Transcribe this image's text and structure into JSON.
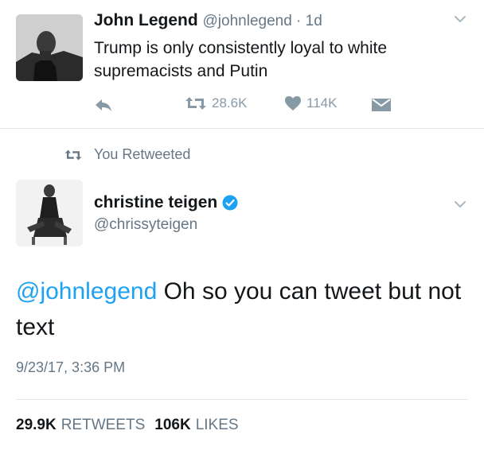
{
  "tweet1": {
    "author_name": "John Legend",
    "author_handle": "@johnlegend",
    "time_sep": " · ",
    "time_ago": "1d",
    "text": "Trump is only consistently loyal to white supremacists and Putin",
    "retweet_count": "28.6K",
    "like_count": "114K"
  },
  "retweet_banner": {
    "label": "You Retweeted"
  },
  "tweet2": {
    "author_name": "christine teigen",
    "author_handle": "@chrissyteigen",
    "mention": "@johnlegend",
    "text": " Oh so you can tweet but not text",
    "timestamp": "9/23/17, 3:36 PM",
    "retweets_count": "29.9K",
    "retweets_label": "RETWEETS",
    "likes_count": "106K",
    "likes_label": "LIKES"
  },
  "icons": {
    "reply": "reply-icon",
    "retweet": "retweet-icon",
    "like": "heart-icon",
    "dm": "envelope-icon",
    "caret": "chevron-down-icon",
    "verified": "verified-badge-icon"
  },
  "colors": {
    "accent": "#1da1f2",
    "secondary_text": "#657786",
    "icon_gray": "#8899a6",
    "primary_text": "#14171a"
  }
}
